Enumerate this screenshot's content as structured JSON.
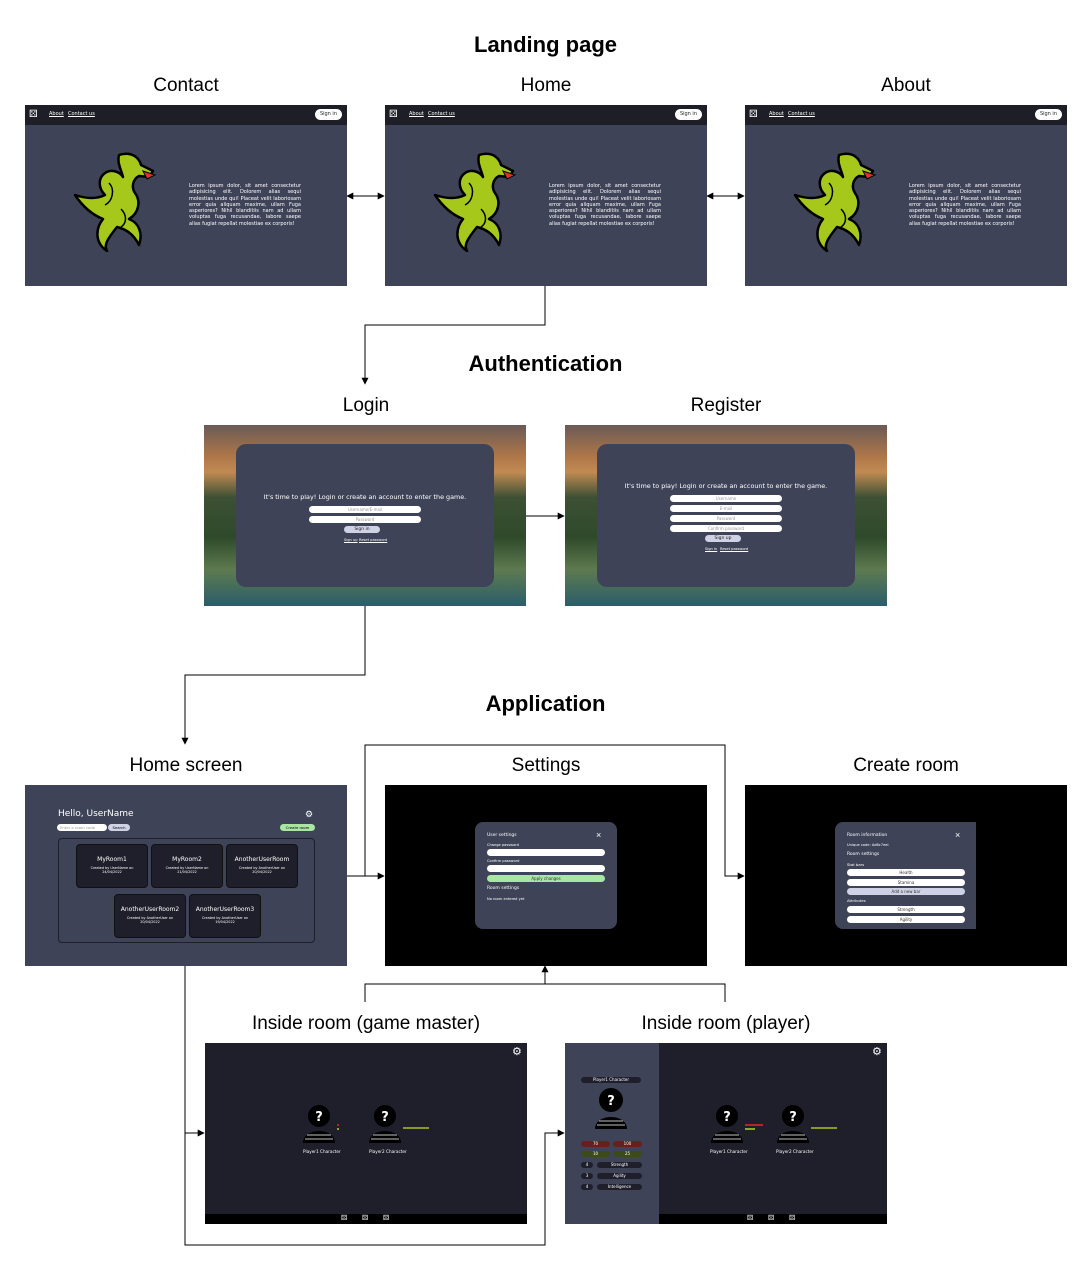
{
  "sections": {
    "landing": "Landing page",
    "auth": "Authentication",
    "app": "Application"
  },
  "labels": {
    "contact": "Contact",
    "home": "Home",
    "about": "About",
    "login": "Login",
    "register": "Register",
    "home_screen": "Home screen",
    "settings": "Settings",
    "create_room": "Create room",
    "room_gm": "Inside room (game master)",
    "room_player": "Inside room (player)"
  },
  "nav": {
    "about": "About",
    "contact": "Contact us",
    "sign_in": "Sign in"
  },
  "lorem": "Lorem ipsum dolor, sit amet consectetur adipisicing elit. Dolorem alias sequi molestias unde qui! Placeat velit laboriosam error quia aliquam maxime, ullam Fuga asperiores? Nihil blanditiis nam ad ullam voluptas fuga recusandae, labore saepe alias fugiat repellat molestiae ex corporis!",
  "auth": {
    "title": "It's time to play! Login or create an account to enter the game.",
    "username_email": "Username/E-mail",
    "password": "Password",
    "sign_in": "Sign in",
    "sign_up_link": "Sign up",
    "reset_link": "Reset password",
    "username": "Username",
    "email": "E-mail",
    "confirm_password": "Confirm password",
    "sign_up": "Sign up",
    "sign_in_link": "Sign in"
  },
  "home_screen": {
    "greeting": "Hello, UserName",
    "search_placeholder": "Enter a room code",
    "search_btn": "Search",
    "create_btn": "Create room",
    "rooms": [
      {
        "name": "MyRoom1",
        "sub": "Created by UserName on 24/04/2022"
      },
      {
        "name": "MyRoom2",
        "sub": "Created by UserName on 21/04/2022"
      },
      {
        "name": "AnotherUserRoom",
        "sub": "Created by AnotherUser on 20/04/2022"
      },
      {
        "name": "AnotherUserRoom2",
        "sub": "Created by AnotherUser on 20/04/2022"
      },
      {
        "name": "AnotherUserRoom3",
        "sub": "Created by AnotherUser on 19/04/2022"
      }
    ]
  },
  "settings": {
    "user_settings": "User settings",
    "change_password": "Change password",
    "confirm_password": "Confirm password",
    "apply": "Apply changes",
    "room_settings": "Room settings",
    "no_room": "No room entered yet"
  },
  "create_room": {
    "room_info": "Room information",
    "unique_code": "Unique code: Ad6c7eel",
    "room_settings": "Room settings",
    "stat_bars": "Stat bars",
    "health": "Health",
    "stamina": "Stamina",
    "add_bar": "Add a new bar",
    "attributes": "Attributes",
    "strength": "Strength",
    "agility": "Agility"
  },
  "room": {
    "p1": "Player1 Character",
    "p2": "Player2 Character",
    "panel_title": "Player1 Character",
    "stats": [
      "70",
      "100",
      "10",
      "25"
    ],
    "attrs": [
      {
        "n": "4",
        "name": "Strength"
      },
      {
        "n": "3",
        "name": "Agility"
      },
      {
        "n": "4",
        "name": "Intelligence"
      }
    ]
  },
  "colors": {
    "frame_bg": "#3f4358",
    "navbar": "#1e1e26",
    "dragon": "#a6c81b",
    "room_bg": "#1e1f2b",
    "green_btn": "#a8e6a3"
  }
}
